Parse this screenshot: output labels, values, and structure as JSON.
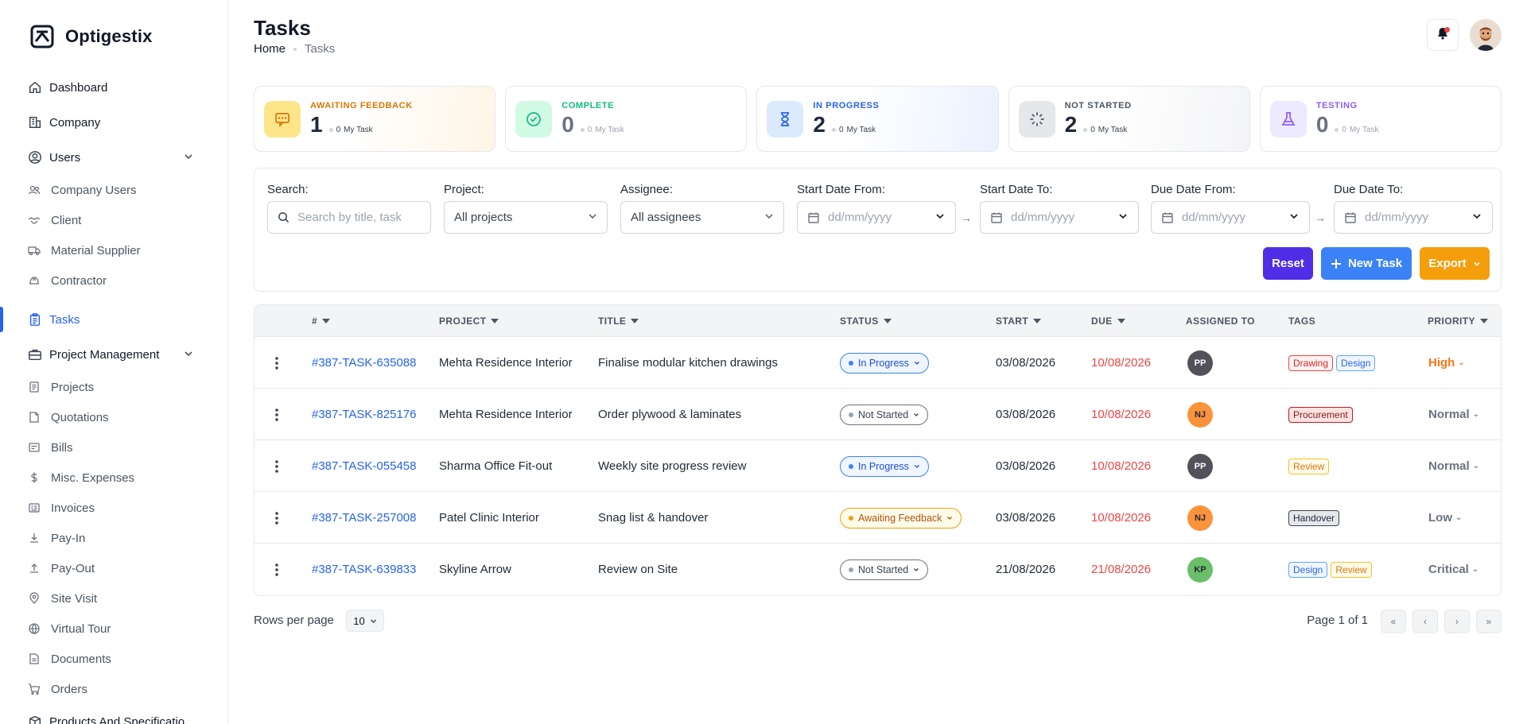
{
  "brand": {
    "name": "Optigestix"
  },
  "sidebar": {
    "dashboard": "Dashboard",
    "company": "Company",
    "users": "Users",
    "users_children": [
      "Company Users",
      "Client",
      "Material Supplier",
      "Contractor"
    ],
    "tasks": "Tasks",
    "project_management": "Project Management",
    "pm_children": [
      "Projects",
      "Quotations",
      "Bills",
      "Misc. Expenses",
      "Invoices",
      "Pay-In",
      "Pay-Out",
      "Site Visit",
      "Virtual Tour",
      "Documents",
      "Orders"
    ],
    "products": "Products And Specificatio"
  },
  "header": {
    "title": "Tasks",
    "breadcrumb_home": "Home",
    "breadcrumb_current": "Tasks"
  },
  "stats": [
    {
      "label": "AWAITING FEEDBACK",
      "count": "1",
      "my": "0",
      "my_label": "My Task",
      "color": "#d97706"
    },
    {
      "label": "COMPLETE",
      "count": "0",
      "my": "0",
      "my_label": "My Task",
      "color": "#10b981"
    },
    {
      "label": "IN PROGRESS",
      "count": "2",
      "my": "0",
      "my_label": "My Task",
      "color": "#2563eb"
    },
    {
      "label": "NOT STARTED",
      "count": "2",
      "my": "0",
      "my_label": "My Task",
      "color": "#4b5563"
    },
    {
      "label": "TESTING",
      "count": "0",
      "my": "0",
      "my_label": "My Task",
      "color": "#8b5cf6"
    }
  ],
  "filters": {
    "search_label": "Search:",
    "search_placeholder": "Search by title, task",
    "project_label": "Project:",
    "project_value": "All projects",
    "assignee_label": "Assignee:",
    "assignee_value": "All assignees",
    "start_from_label": "Start Date From:",
    "start_to_label": "Start Date To:",
    "due_from_label": "Due Date From:",
    "due_to_label": "Due Date To:",
    "date_placeholder": "dd/mm/yyyy",
    "reset": "Reset",
    "new_task": "New Task",
    "export": "Export"
  },
  "table": {
    "headers": {
      "id": "#",
      "project": "PROJECT",
      "title": "TITLE",
      "status": "STATUS",
      "start": "START",
      "due": "DUE",
      "assigned": "ASSIGNED TO",
      "tags": "TAGS",
      "priority": "PRIORITY"
    },
    "rows": [
      {
        "id": "#387-TASK-635088",
        "project": "Mehta Residence Interior",
        "title": "Finalise modular kitchen drawings",
        "status": "In Progress",
        "start": "03/08/2026",
        "due": "10/08/2026",
        "assignee": "PP",
        "tags": [
          "Drawing",
          "Design"
        ],
        "priority": "High"
      },
      {
        "id": "#387-TASK-825176",
        "project": "Mehta Residence Interior",
        "title": "Order plywood & laminates",
        "status": "Not Started",
        "start": "03/08/2026",
        "due": "10/08/2026",
        "assignee": "NJ",
        "tags": [
          "Procurement"
        ],
        "priority": "Normal"
      },
      {
        "id": "#387-TASK-055458",
        "project": "Sharma Office Fit-out",
        "title": "Weekly site progress review",
        "status": "In Progress",
        "start": "03/08/2026",
        "due": "10/08/2026",
        "assignee": "PP",
        "tags": [
          "Review"
        ],
        "priority": "Normal"
      },
      {
        "id": "#387-TASK-257008",
        "project": "Patel Clinic Interior",
        "title": "Snag list & handover",
        "status": "Awaiting Feedback",
        "start": "03/08/2026",
        "due": "10/08/2026",
        "assignee": "NJ",
        "tags": [
          "Handover"
        ],
        "priority": "Low"
      },
      {
        "id": "#387-TASK-639833",
        "project": "Skyline Arrow",
        "title": "Review on Site",
        "status": "Not Started",
        "start": "21/08/2026",
        "due": "21/08/2026",
        "assignee": "KP",
        "tags": [
          "Design",
          "Review"
        ],
        "priority": "Critical"
      }
    ]
  },
  "footer": {
    "rows_label": "Rows per page",
    "rows_value": "10",
    "page_info": "Page 1 of 1"
  },
  "colors": {
    "accent": "#2563eb",
    "reset": "#4f2ee8",
    "new_task": "#3b82f6",
    "export": "#f59e0b",
    "due": "#ef4444"
  }
}
